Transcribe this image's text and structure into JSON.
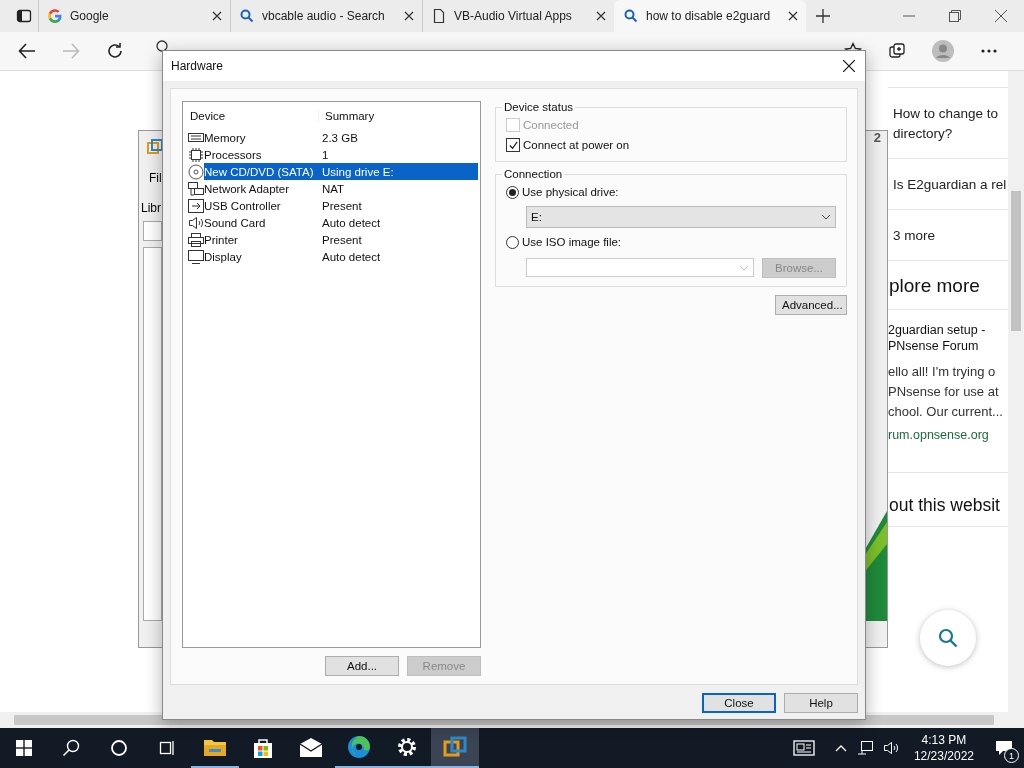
{
  "browser": {
    "tabs": [
      {
        "title": "Google",
        "kind": "google",
        "selected": false
      },
      {
        "title": "vbcable audio - Search",
        "kind": "search",
        "selected": false
      },
      {
        "title": "VB-Audio Virtual Apps",
        "kind": "page",
        "selected": false
      },
      {
        "title": "how to disable e2guard",
        "kind": "search",
        "selected": true
      }
    ]
  },
  "web_page": {
    "questions": [
      {
        "lines": [
          "How to change to",
          "directory?"
        ]
      },
      {
        "lines": [
          "Is E2guardian a rel"
        ]
      }
    ],
    "more": "3 more",
    "explore_heading": "plore more",
    "result": {
      "title": [
        "2guardian setup -",
        "PNsense Forum"
      ],
      "snippet": [
        "ello all! I'm trying o",
        "PNsense for use at",
        "chool. Our current..."
      ],
      "url": "rum.opnsense.org"
    },
    "about_heading": "out this websit"
  },
  "background_app": {
    "badge": "2",
    "menu": "Fil",
    "library": "Libr"
  },
  "dialog": {
    "title": "Hardware",
    "columns": [
      "Device",
      "Summary"
    ],
    "devices": [
      {
        "name": "Memory",
        "summary": "2.3 GB",
        "kind": "memory",
        "selected": false
      },
      {
        "name": "Processors",
        "summary": "1",
        "kind": "cpu",
        "selected": false
      },
      {
        "name": "New CD/DVD (SATA)",
        "summary": "Using drive E:",
        "kind": "disc",
        "selected": true
      },
      {
        "name": "Network Adapter",
        "summary": "NAT",
        "kind": "network",
        "selected": false
      },
      {
        "name": "USB Controller",
        "summary": "Present",
        "kind": "usb",
        "selected": false
      },
      {
        "name": "Sound Card",
        "summary": "Auto detect",
        "kind": "sound",
        "selected": false
      },
      {
        "name": "Printer",
        "summary": "Present",
        "kind": "printer",
        "selected": false
      },
      {
        "name": "Display",
        "summary": "Auto detect",
        "kind": "display",
        "selected": false
      }
    ],
    "list_buttons": [
      {
        "label": "Add...",
        "disabled": false
      },
      {
        "label": "Remove",
        "disabled": true
      }
    ],
    "device_status": {
      "title": "Device status",
      "options": [
        {
          "label": "Connected",
          "checked": false,
          "disabled": true
        },
        {
          "label": "Connect at power on",
          "checked": true,
          "disabled": false
        }
      ]
    },
    "connection": {
      "title": "Connection",
      "physical": {
        "label": "Use physical drive:",
        "selected": true
      },
      "drive": "E:",
      "iso": {
        "label": "Use ISO image file:",
        "selected": false
      },
      "browse": {
        "label": "Browse...",
        "disabled": true
      }
    },
    "advanced": "Advanced...",
    "footer_buttons": [
      {
        "label": "Close",
        "default": true
      },
      {
        "label": "Help",
        "default": false
      }
    ]
  },
  "taskbar": {
    "apps": [
      {
        "kind": "folder",
        "running": true,
        "active": false
      },
      {
        "kind": "store",
        "running": false,
        "active": false
      },
      {
        "kind": "mail",
        "running": false,
        "active": false
      },
      {
        "kind": "edge",
        "running": true,
        "active": false
      },
      {
        "kind": "gear",
        "running": true,
        "active": false
      },
      {
        "kind": "vmware",
        "running": true,
        "active": true
      }
    ],
    "time": "4:13 PM",
    "date": "12/23/2022",
    "notifications": "1"
  }
}
